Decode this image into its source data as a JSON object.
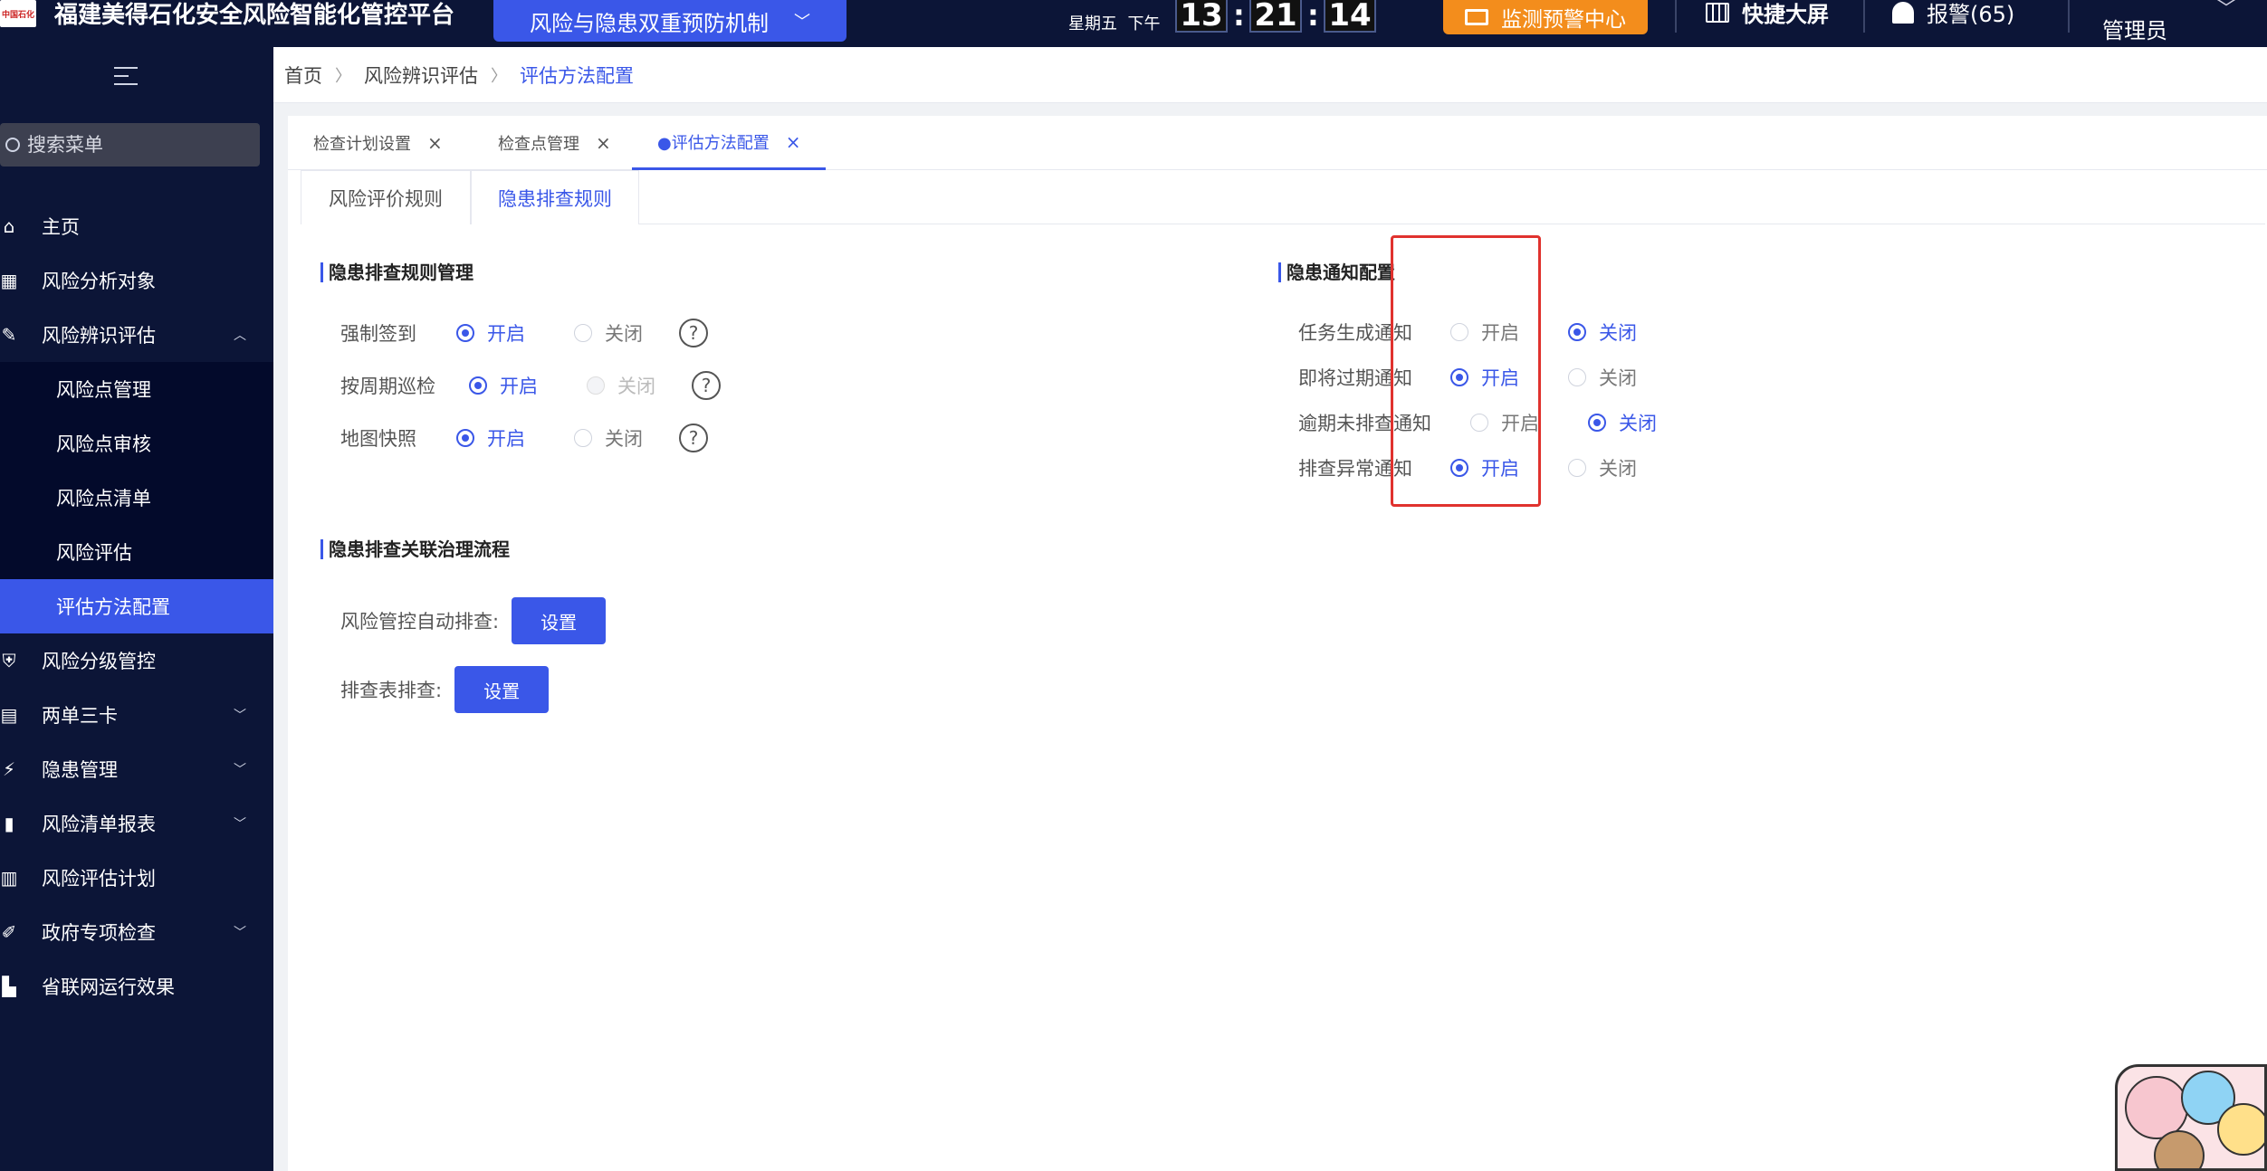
{
  "header": {
    "logo_text": "中国石化",
    "title": "福建美得石化安全风险智能化管控平台",
    "mechanism_button": "风险与隐患双重预防机制",
    "weekday": "星期五",
    "period": "下午",
    "clock": {
      "hours": "13",
      "minutes": "21",
      "seconds": "14",
      "sep": ":"
    },
    "monitor_center": "监测预警中心",
    "quick_screen": "快捷大屏",
    "alarm": "报警(65)",
    "user": "管理员"
  },
  "sidebar": {
    "search_placeholder": "搜索菜单",
    "items": [
      {
        "label": "主页",
        "icon": "home-icon"
      },
      {
        "label": "风险分析对象",
        "icon": "table-icon"
      },
      {
        "label": "风险辨识评估",
        "icon": "edit-icon",
        "expanded": true
      },
      {
        "label": "风险点管理"
      },
      {
        "label": "风险点审核"
      },
      {
        "label": "风险点清单"
      },
      {
        "label": "风险评估"
      },
      {
        "label": "评估方法配置",
        "active": true
      },
      {
        "label": "风险分级管控",
        "icon": "shield-icon"
      },
      {
        "label": "两单三卡",
        "icon": "clipboard-icon"
      },
      {
        "label": "隐患管理",
        "icon": "lightning-icon"
      },
      {
        "label": "风险清单报表",
        "icon": "bar-chart-icon"
      },
      {
        "label": "风险评估计划",
        "icon": "document-icon"
      },
      {
        "label": "政府专项检查",
        "icon": "edit-doc-icon"
      },
      {
        "label": "省联网运行效果",
        "icon": "building-icon"
      }
    ]
  },
  "breadcrumb": [
    "首页",
    "风险辨识评估",
    "评估方法配置"
  ],
  "page_tabs": [
    {
      "label": "检查计划设置"
    },
    {
      "label": "检查点管理"
    },
    {
      "label": "●评估方法配置",
      "active": true
    }
  ],
  "sub_tabs": [
    {
      "label": "风险评价规则"
    },
    {
      "label": "隐患排查规则",
      "active": true
    }
  ],
  "rules_section": {
    "title": "隐患排查规则管理",
    "option_on": "开启",
    "option_off": "关闭",
    "rows": [
      {
        "label": "强制签到",
        "value": "开启"
      },
      {
        "label": "按周期巡检",
        "value": "开启",
        "off_disabled": true
      },
      {
        "label": "地图快照",
        "value": "开启"
      }
    ]
  },
  "notify_section": {
    "title": "隐患通知配置",
    "rows": [
      {
        "label": "任务生成通知",
        "value": "关闭"
      },
      {
        "label": "即将过期通知",
        "value": "开启"
      },
      {
        "label": "逾期未排查通知",
        "value": "关闭"
      },
      {
        "label": "排查异常通知",
        "value": "开启"
      }
    ]
  },
  "flow_section": {
    "title": "隐患排查关联治理流程",
    "rows": [
      {
        "label": "风险管控自动排查:",
        "button": "设置"
      },
      {
        "label": "排查表排查:",
        "button": "设置"
      }
    ]
  },
  "colors": {
    "primary": "#3a57e8",
    "nav_bg": "#0c1537",
    "warning": "#f38d1c",
    "highlight": "#e0322e"
  }
}
